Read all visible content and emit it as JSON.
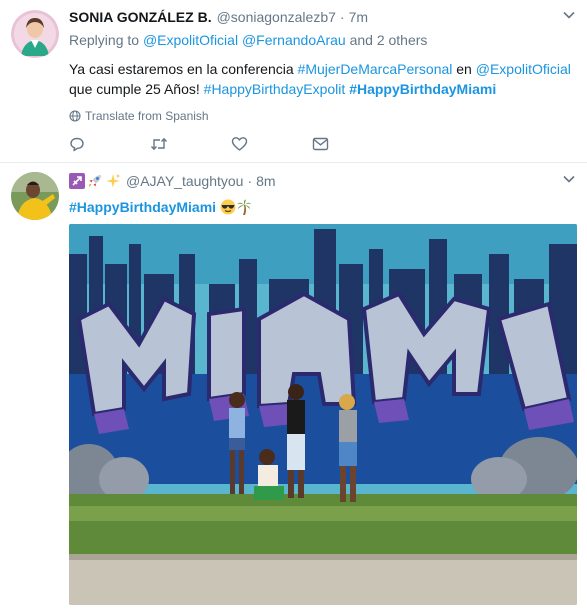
{
  "tweets": [
    {
      "fullname": "SONIA GONZÁLEZ B.",
      "username": "@soniagonzalezb7",
      "separator": "·",
      "time": "7m",
      "replying_label": "Replying to",
      "reply_mention_1": "@ExpolitOficial",
      "reply_mention_2": "@FernandoArau",
      "reply_others": "and 2 others",
      "text_part_1": "Ya casi estaremos en la conferencia ",
      "hashtag_1": "#MujerDeMarcaPersonal",
      "text_part_2": " en ",
      "mention_1": "@ExpolitOficial",
      "text_part_3": " que cumple 25 Años! ",
      "hashtag_2": "#HappyBirthdayExpolit",
      "text_part_4": " ",
      "hashtag_3": "#HappyBirthdayMiami",
      "translate_label": "Translate from Spanish",
      "avatar_icon": "person-avatar-icon"
    },
    {
      "username": "@AJAY_taughtyou",
      "separator": "·",
      "time": "8m",
      "name_emojis": [
        "sagittarius-icon",
        "rocket-icon",
        "sparkles-icon"
      ],
      "hashtag": "#HappyBirthdayMiami",
      "text_emojis": [
        "sunglasses-face-icon",
        "palm-tree-icon"
      ],
      "photo_icon": "miami-graffiti-photo",
      "avatar_icon": "person-avatar-icon"
    }
  ],
  "colors": {
    "link": "#1b95e0",
    "secondary": "#657786",
    "text": "#14171a",
    "divider": "#e6ecf0"
  }
}
